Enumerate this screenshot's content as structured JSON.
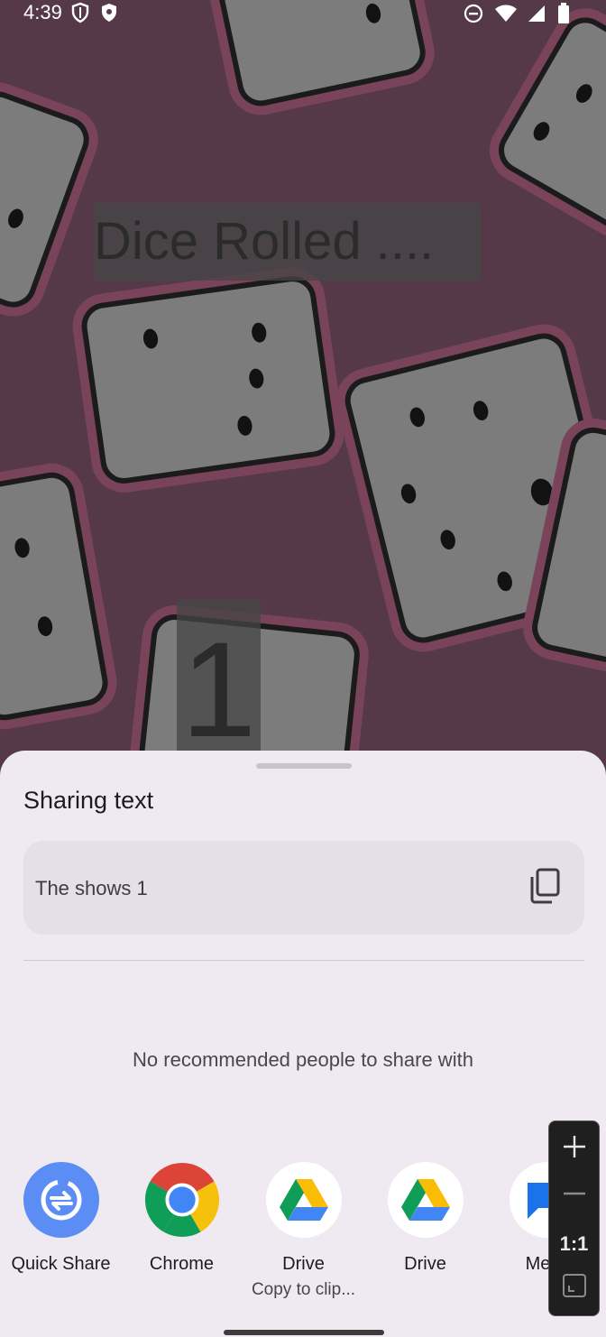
{
  "status_bar": {
    "time": "4:39",
    "left_icons": [
      "vpn-shield-icon",
      "security-shield-icon"
    ],
    "right_icons": [
      "dnd-icon",
      "wifi-icon",
      "signal-icon",
      "battery-icon"
    ]
  },
  "background_app": {
    "title": "Dice Rolled ....",
    "number": "1",
    "colors": {
      "background": "#8a5c75",
      "die_face": "#c9c9c9",
      "die_glow": "#c46f92"
    }
  },
  "share_sheet": {
    "title": "Sharing text",
    "preview_text": "The shows 1",
    "copy_icon": "copy-icon",
    "no_people_message": "No recommended people to share with",
    "targets": [
      {
        "label": "Quick Share",
        "sub": "",
        "icon": "quick-share-icon"
      },
      {
        "label": "Chrome",
        "sub": "",
        "icon": "chrome-icon"
      },
      {
        "label": "Drive",
        "sub": "Copy to clip...",
        "icon": "drive-icon"
      },
      {
        "label": "Drive",
        "sub": "",
        "icon": "drive-icon"
      },
      {
        "label": "Mess",
        "sub": "",
        "icon": "messages-icon"
      }
    ]
  },
  "zoom_control": {
    "zoom_in_icon": "plus-icon",
    "zoom_out_icon": "minus-icon",
    "ratio_label": "1:1",
    "fit_icon": "fit-screen-icon"
  }
}
